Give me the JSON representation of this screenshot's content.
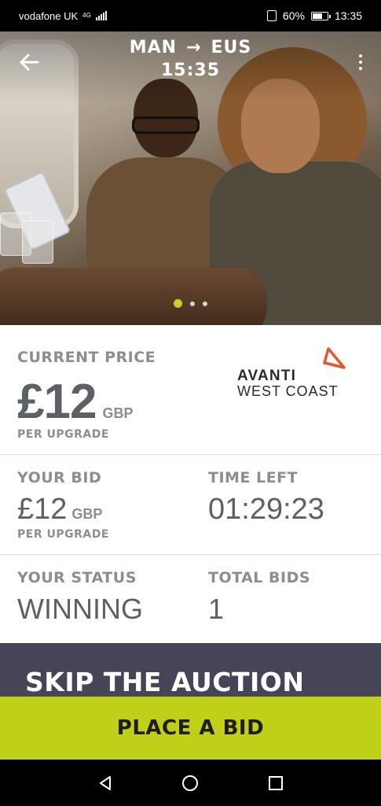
{
  "status_bar": {
    "carrier": "vodafone UK",
    "network": "4G",
    "battery": "60%",
    "time": "13:35"
  },
  "header": {
    "origin": "MAN",
    "arrow": "→",
    "destination": "EUS",
    "departure_time": "15:35",
    "carousel_dots": 3,
    "carousel_active": 0
  },
  "current_price": {
    "label": "CURRENT PRICE",
    "amount": "£12",
    "currency": "GBP",
    "unit": "PER UPGRADE"
  },
  "operator_logo": {
    "line1": "AVANTI",
    "line2": "WEST COAST",
    "accent_color": "#e4572e"
  },
  "your_bid": {
    "label": "YOUR BID",
    "amount": "£12",
    "currency": "GBP",
    "unit": "PER UPGRADE"
  },
  "time_left": {
    "label": "TIME LEFT",
    "value": "01:29:23"
  },
  "your_status": {
    "label": "YOUR STATUS",
    "value": "WINNING"
  },
  "total_bids": {
    "label": "TOTAL BIDS",
    "value": "1"
  },
  "skip_auction": {
    "label": "SKIP THE AUCTION"
  },
  "place_bid": {
    "label": "PLACE A BID"
  },
  "colors": {
    "accent_green": "#c0d018",
    "dark_panel": "#454557",
    "label_grey": "#8b8d93",
    "value_grey": "#5e6068"
  },
  "nav": {
    "back": "back-icon",
    "home": "home-icon",
    "recents": "recents-icon"
  }
}
